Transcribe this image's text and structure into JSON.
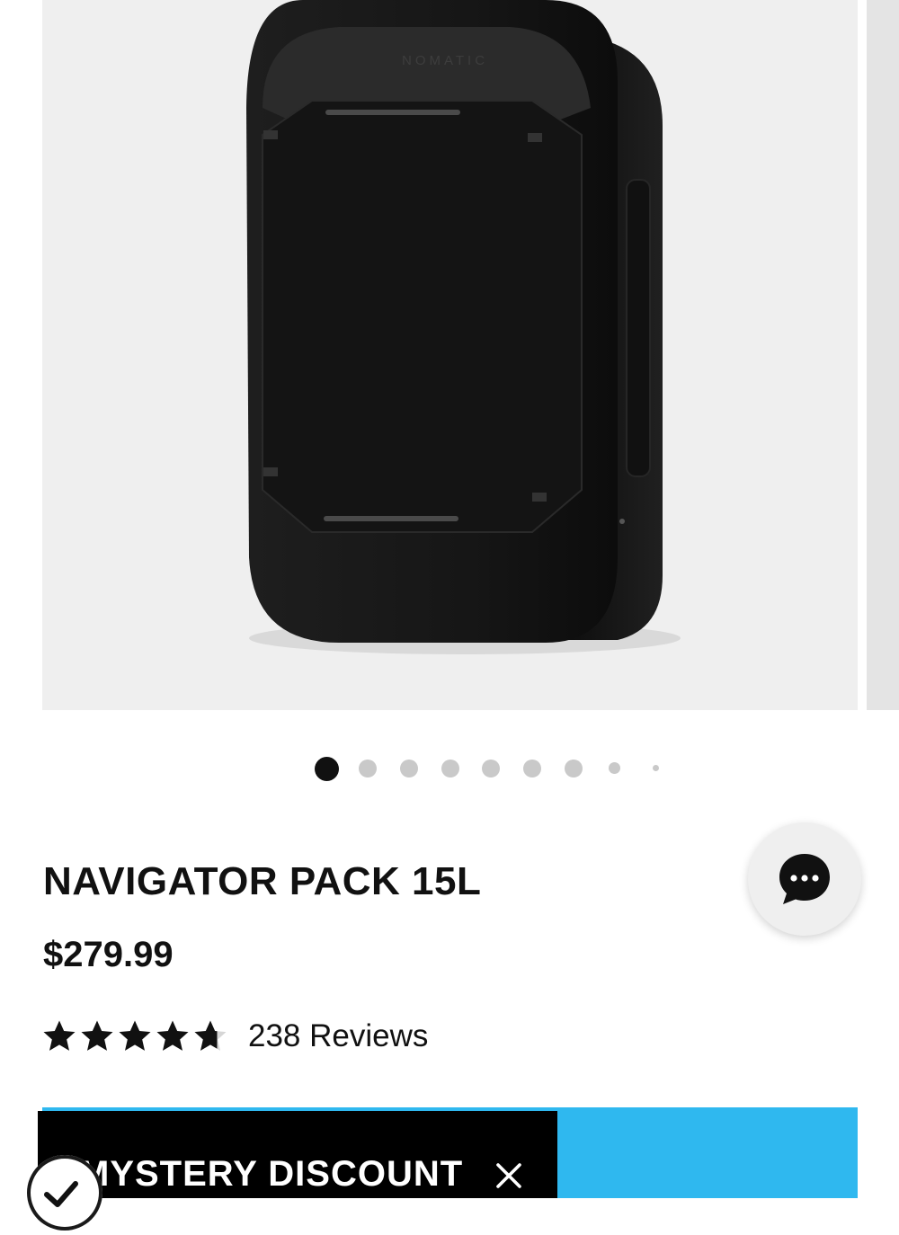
{
  "gallery": {
    "total_slides": 9,
    "active_slide": 1,
    "product_image": "black-backpack-image"
  },
  "chat": {
    "icon": "chat-bubble-icon"
  },
  "product": {
    "title": "NAVIGATOR PACK 15L",
    "price": "$279.99",
    "rating": 4.7,
    "rating_max": 5,
    "reviews_label": "238 Reviews"
  },
  "promo": {
    "label": "MYSTERY DISCOUNT",
    "close_icon": "close-icon",
    "badge_icon": "checkmark-icon"
  },
  "colors": {
    "accent": "#2fb8ef",
    "promo_bg": "#000000",
    "star": "#111111",
    "dot_active": "#111111",
    "dot_inactive": "#c9c9c9"
  }
}
